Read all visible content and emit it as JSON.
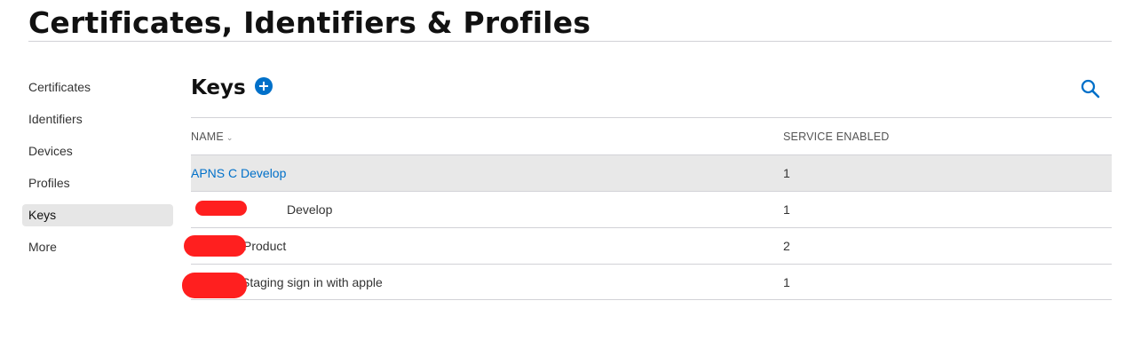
{
  "header": {
    "title": "Certificates, Identifiers & Profiles"
  },
  "sidebar": {
    "items": [
      {
        "label": "Certificates",
        "active": false
      },
      {
        "label": "Identifiers",
        "active": false
      },
      {
        "label": "Devices",
        "active": false
      },
      {
        "label": "Profiles",
        "active": false
      },
      {
        "label": "Keys",
        "active": true
      },
      {
        "label": "More",
        "active": false
      }
    ]
  },
  "main": {
    "title": "Keys",
    "add_icon": "plus-circle-icon",
    "search_icon": "search-icon",
    "table": {
      "columns": {
        "name": "NAME",
        "service": "SERVICE ENABLED"
      },
      "sort_icon": "chevron-down-icon",
      "rows": [
        {
          "name": "APNS C Develop",
          "service": "1",
          "redacted": false
        },
        {
          "name": "Develop",
          "service": "1",
          "redacted": true
        },
        {
          "name": "Product",
          "service": "2",
          "redacted": true
        },
        {
          "name": "Staging sign in with apple",
          "service": "1",
          "redacted": true
        }
      ]
    }
  },
  "colors": {
    "accent": "#0070c9",
    "redaction": "#ff1f1f",
    "active_bg": "#e6e6e6"
  }
}
